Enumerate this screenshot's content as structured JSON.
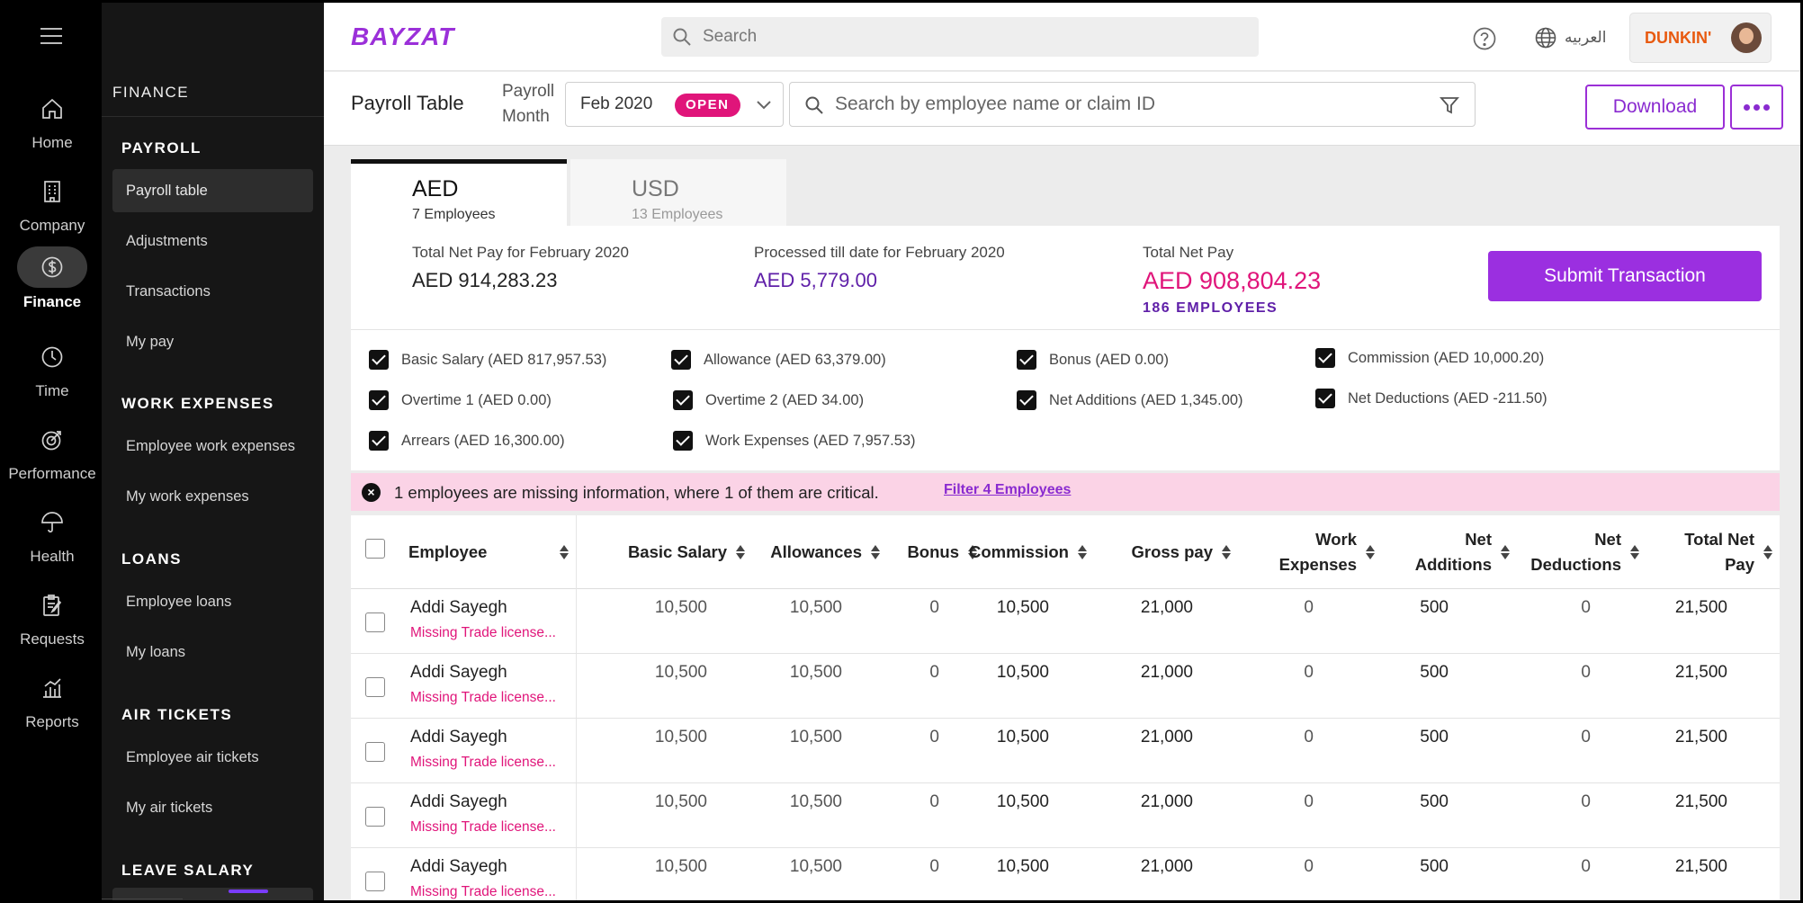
{
  "nav": {
    "items": [
      {
        "label": "Home",
        "icon": "home-icon"
      },
      {
        "label": "Company",
        "icon": "building-icon"
      },
      {
        "label": "Finance",
        "icon": "dollar-icon",
        "active": true
      },
      {
        "label": "Time",
        "icon": "clock-icon"
      },
      {
        "label": "Performance",
        "icon": "target-icon"
      },
      {
        "label": "Health",
        "icon": "umbrella-icon"
      },
      {
        "label": "Requests",
        "icon": "clipboard-icon"
      },
      {
        "label": "Reports",
        "icon": "chart-icon"
      }
    ]
  },
  "sidebar": {
    "title": "FINANCE",
    "sections": [
      {
        "heading": "PAYROLL",
        "items": [
          "Payroll table",
          "Adjustments",
          "Transactions",
          "My pay"
        ]
      },
      {
        "heading": "WORK EXPENSES",
        "items": [
          "Employee work expenses",
          "My work expenses"
        ]
      },
      {
        "heading": "LOANS",
        "items": [
          "Employee loans",
          "My loans"
        ]
      },
      {
        "heading": "AIR TICKETS",
        "items": [
          "Employee air tickets",
          "My air tickets"
        ]
      },
      {
        "heading": "LEAVE SALARY",
        "items": []
      }
    ]
  },
  "topbar": {
    "logo": "BAYZAT",
    "search_placeholder": "Search",
    "language": "العربيه",
    "brand": "DUNKIN'"
  },
  "subbar": {
    "title": "Payroll Table",
    "month_label_1": "Payroll",
    "month_label_2": "Month",
    "month_value": "Feb 2020",
    "month_status": "OPEN",
    "search_placeholder": "Search by employee name or claim ID",
    "download_label": "Download"
  },
  "tabs": [
    {
      "currency": "AED",
      "count": "7 Employees"
    },
    {
      "currency": "USD",
      "count": "13 Employees"
    }
  ],
  "summary": {
    "total_label": "Total Net Pay for February 2020",
    "total_value": "AED 914,283.23",
    "processed_label": "Processed till date for February 2020",
    "processed_value": "AED 5,779.00",
    "net_label": "Total Net Pay",
    "net_value": "AED 908,804.23",
    "employees": "186 EMPLOYEES",
    "submit_label": "Submit Transaction"
  },
  "components": [
    "Basic Salary (AED 817,957.53)",
    "Allowance (AED 63,379.00)",
    "Bonus (AED 0.00)",
    "Commission (AED 10,000.20)",
    "Overtime 1 (AED 0.00)",
    "Overtime 2 (AED 34.00)",
    "Net Additions (AED 1,345.00)",
    "Net Deductions (AED -211.50)",
    "Arrears (AED 16,300.00)",
    "Work Expenses (AED 7,957.53)"
  ],
  "alert": {
    "message": "1 employees are missing information, where 1 of them are critical.",
    "link": "Filter 4 Employees"
  },
  "table": {
    "columns": [
      "Employee",
      "Basic Salary",
      "Allowances",
      "Bonus",
      "Commission",
      "Gross pay",
      "Work Expenses",
      "Net Additions",
      "Net Deductions",
      "Total Net Pay"
    ],
    "rows": [
      {
        "name": "Addi Sayegh",
        "warning": "Missing Trade license...",
        "values": [
          "10,500",
          "10,500",
          "0",
          "10,500",
          "21,000",
          "0",
          "500",
          "0",
          "21,500"
        ]
      },
      {
        "name": "Addi Sayegh",
        "warning": "Missing Trade license...",
        "values": [
          "10,500",
          "10,500",
          "0",
          "10,500",
          "21,000",
          "0",
          "500",
          "0",
          "21,500"
        ]
      },
      {
        "name": "Addi Sayegh",
        "warning": "Missing Trade license...",
        "values": [
          "10,500",
          "10,500",
          "0",
          "10,500",
          "21,000",
          "0",
          "500",
          "0",
          "21,500"
        ]
      },
      {
        "name": "Addi Sayegh",
        "warning": "Missing Trade license...",
        "values": [
          "10,500",
          "10,500",
          "0",
          "10,500",
          "21,000",
          "0",
          "500",
          "0",
          "21,500"
        ]
      },
      {
        "name": "Addi Sayegh",
        "warning": "Missing Trade license...",
        "values": [
          "10,500",
          "10,500",
          "0",
          "10,500",
          "21,000",
          "0",
          "500",
          "0",
          "21,500"
        ]
      }
    ]
  }
}
